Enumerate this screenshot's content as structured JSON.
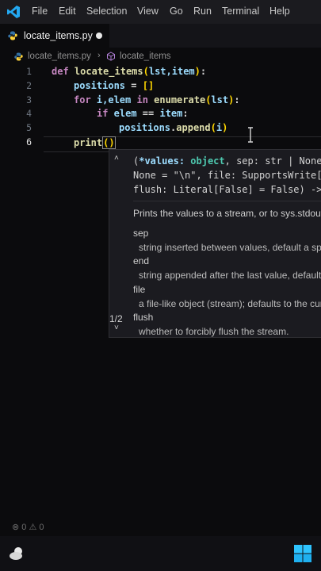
{
  "menubar": {
    "items": [
      "File",
      "Edit",
      "Selection",
      "View",
      "Go",
      "Run",
      "Terminal",
      "Help"
    ]
  },
  "tab": {
    "label": "locate_items.py"
  },
  "breadcrumb": {
    "file": "locate_items.py",
    "symbol": "locate_items"
  },
  "editor": {
    "line_numbers": [
      "1",
      "2",
      "3",
      "4",
      "5",
      "6"
    ],
    "active_line": "6",
    "tokens": {
      "l1_def": "def",
      "l1_fn": "locate_items",
      "l1_open": "(",
      "l1_params": "lst,item",
      "l1_close": ")",
      "l1_colon": ":",
      "l2_var": "positions",
      "l2_eq": " = ",
      "l2_list": "[]",
      "l3_for": "for",
      "l3_vars": " i,elem ",
      "l3_in": "in",
      "l3_fn": " enumerate",
      "l3_open": "(",
      "l3_arg": "lst",
      "l3_close": ")",
      "l3_colon": ":",
      "l4_if": "if",
      "l4_var": " elem",
      "l4_op": " == ",
      "l4_item": "item",
      "l4_colon": ":",
      "l5_var": "positions",
      "l5_dot": ".",
      "l5_fn": "append",
      "l5_open": "(",
      "l5_arg": "i",
      "l5_close": ")",
      "l6_fn": "print",
      "l6_open": "(",
      "l6_close": ")"
    }
  },
  "signature_help": {
    "overload": "1/2",
    "sig_line1_a": "(",
    "sig_line1_b": "*values",
    "sig_line1_c": ": ",
    "sig_line1_d": "object",
    "sig_line1_e": ", sep: str | None",
    "sig_line2": "None = \"\\n\", file: SupportsWrite[",
    "sig_line3": "flush: Literal[False] = False) ->",
    "summary": "Prints the values to a stream, or to sys.stdout",
    "params": [
      {
        "name": "sep",
        "desc": "string inserted between values, default a space."
      },
      {
        "name": "end",
        "desc": "string appended after the last value, default a newline."
      },
      {
        "name": "file",
        "desc": "a file-like object (stream); defaults to the current sys.stdout."
      },
      {
        "name": "flush",
        "desc": "whether to forcibly flush the stream."
      }
    ]
  },
  "status": {
    "errors": "0",
    "warnings": "0"
  },
  "colors": {
    "keyword": "#c586c0",
    "function": "#dcdcaa",
    "variable": "#9cdcfe",
    "bracket_gold": "#ffd700",
    "bracket_orchid": "#da70d6",
    "bracket_blue": "#179fff",
    "accent": "#0098ff"
  }
}
